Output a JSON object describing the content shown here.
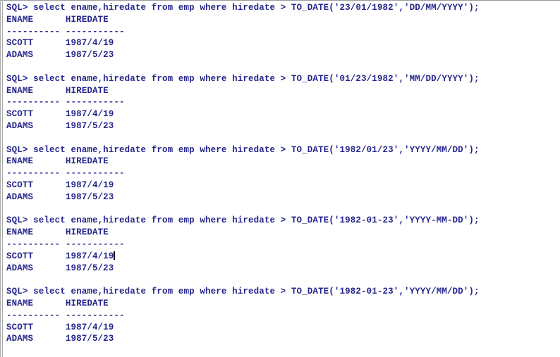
{
  "terminal": {
    "prompt": "SQL> ",
    "text_color": "#26268c",
    "background_color": "#ffffff",
    "border_color": "#9a9a9a",
    "caret_color": "#000000",
    "column_separator": "---------- -----------",
    "header_line": "ENAME      HIREDATE",
    "columns": [
      "ENAME",
      "HIREDATE"
    ],
    "blocks": [
      {
        "command": "SQL> select ename,hiredate from emp where hiredate > TO_DATE('23/01/1982','DD/MM/YYYY');",
        "header": "ENAME      HIREDATE",
        "separator": "---------- -----------",
        "rows": [
          {
            "ename": "SCOTT",
            "hiredate": "1987/4/19",
            "line": "SCOTT      1987/4/19"
          },
          {
            "ename": "ADAMS",
            "hiredate": "1987/5/23",
            "line": "ADAMS      1987/5/23"
          }
        ],
        "caret_after_row": -1
      },
      {
        "command": "SQL> select ename,hiredate from emp where hiredate > TO_DATE('01/23/1982','MM/DD/YYYY');",
        "header": "ENAME      HIREDATE",
        "separator": "---------- -----------",
        "rows": [
          {
            "ename": "SCOTT",
            "hiredate": "1987/4/19",
            "line": "SCOTT      1987/4/19"
          },
          {
            "ename": "ADAMS",
            "hiredate": "1987/5/23",
            "line": "ADAMS      1987/5/23"
          }
        ],
        "caret_after_row": -1
      },
      {
        "command": "SQL> select ename,hiredate from emp where hiredate > TO_DATE('1982/01/23','YYYY/MM/DD');",
        "header": "ENAME      HIREDATE",
        "separator": "---------- -----------",
        "rows": [
          {
            "ename": "SCOTT",
            "hiredate": "1987/4/19",
            "line": "SCOTT      1987/4/19"
          },
          {
            "ename": "ADAMS",
            "hiredate": "1987/5/23",
            "line": "ADAMS      1987/5/23"
          }
        ],
        "caret_after_row": -1
      },
      {
        "command": "SQL> select ename,hiredate from emp where hiredate > TO_DATE('1982-01-23','YYYY-MM-DD');",
        "header": "ENAME      HIREDATE",
        "separator": "---------- -----------",
        "rows": [
          {
            "ename": "SCOTT",
            "hiredate": "1987/4/19",
            "line": "SCOTT      1987/4/19"
          },
          {
            "ename": "ADAMS",
            "hiredate": "1987/5/23",
            "line": "ADAMS      1987/5/23"
          }
        ],
        "caret_after_row": 0
      },
      {
        "command": "SQL> select ename,hiredate from emp where hiredate > TO_DATE('1982-01-23','YYYY/MM/DD');",
        "header": "ENAME      HIREDATE",
        "separator": "---------- -----------",
        "rows": [
          {
            "ename": "SCOTT",
            "hiredate": "1987/4/19",
            "line": "SCOTT      1987/4/19"
          },
          {
            "ename": "ADAMS",
            "hiredate": "1987/5/23",
            "line": "ADAMS      1987/5/23"
          }
        ],
        "caret_after_row": -1
      }
    ]
  }
}
